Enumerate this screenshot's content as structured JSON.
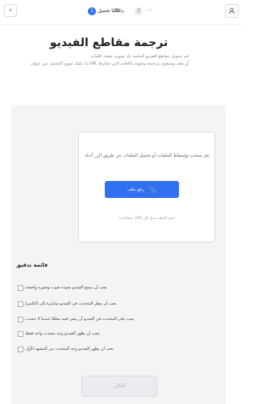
{
  "topbar": {
    "back_icon": "back-arrow-icon",
    "more_label": "···",
    "steps": [
      {
        "number": "1",
        "label": "URL تحميل"
      },
      {
        "number": "2",
        "label": "واتلف"
      }
    ],
    "user_icon": "user-icon",
    "accent_color": "#2f6ff0"
  },
  "header": {
    "title": "ترجمة مقاطع الفيديو",
    "description_line1": "قم بتحويل مقاطع الفيديو الخاصة بك بصوت متعدد اللغات.",
    "description_line2": "أو ملف وسنقوم بترجمته وصوته باللغات التي تختارها URL ما عليك سوى التحميل عبر عنوان"
  },
  "upload": {
    "hint": "قم بسحب وإسقاط الملفات أو تحميل الملفات عن طريق الزر أدناه",
    "button_label": "رفع ملف",
    "button_icon": "paperclip-icon",
    "note": "حجم الملف يصل إلى 200 ميجابايت!"
  },
  "checklist": {
    "title": "قائمة تدقيق",
    "items": [
      "يجب أن يتمتع الفيديو بجودة صوت وصورة واضحة.",
      "يجب أن ينظر المتحدث في الفيديو مباشرة إلى الكاميرا.",
      "يجب على المتحدث في الفيديو أن يبقى فمه مغلقًا عندما لا يتحدث.",
      "يجب أن يظهر الفيديو وجه متحدث واحد فقط.",
      "يجب أن يظهر الفيديو وجه المتحدث من المشهد الأول."
    ]
  },
  "footer": {
    "next_label": "التالي"
  }
}
